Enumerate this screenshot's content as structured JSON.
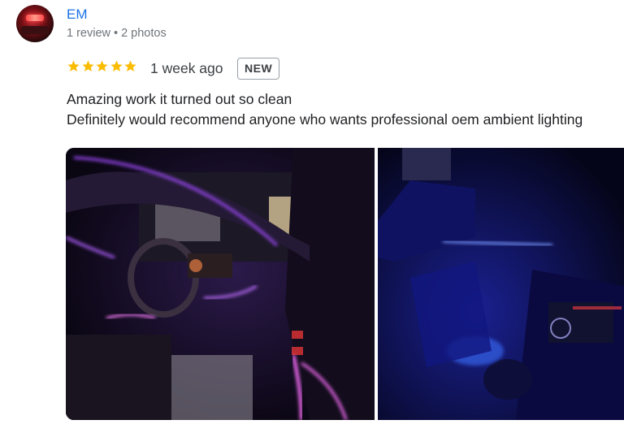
{
  "reviewer": {
    "name": "EM",
    "review_count": "1 review",
    "separator": "•",
    "photo_count": "2 photos"
  },
  "review": {
    "rating": 5,
    "max_rating": 5,
    "time": "1 week ago",
    "badge": "NEW",
    "lines": [
      "Amazing work it turned out so clean",
      "Definitely would recommend anyone who wants professional oem ambient lighting"
    ]
  },
  "photos": [
    {
      "subject": "car interior with purple ambient lighting"
    },
    {
      "subject": "car door panel with blue ambient lighting"
    }
  ],
  "colors": {
    "author_link": "#1a73e8",
    "star": "#fbbc04",
    "meta": "#70757a",
    "body_text": "#202124",
    "photo1_glow": "#a24bff",
    "photo2_glow": "#4d6bff"
  }
}
